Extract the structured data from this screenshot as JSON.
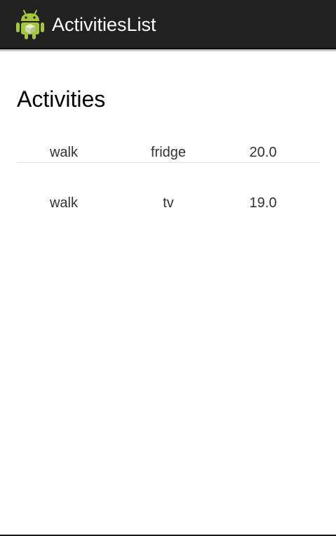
{
  "app_bar": {
    "title": "ActivitiesList",
    "icon": "android-robot-icon",
    "background": "#212121"
  },
  "main": {
    "heading": "Activities",
    "rows": [
      {
        "activity": "walk",
        "item": "fridge",
        "value": "20.0"
      },
      {
        "activity": "walk",
        "item": "tv",
        "value": "19.0"
      }
    ]
  }
}
